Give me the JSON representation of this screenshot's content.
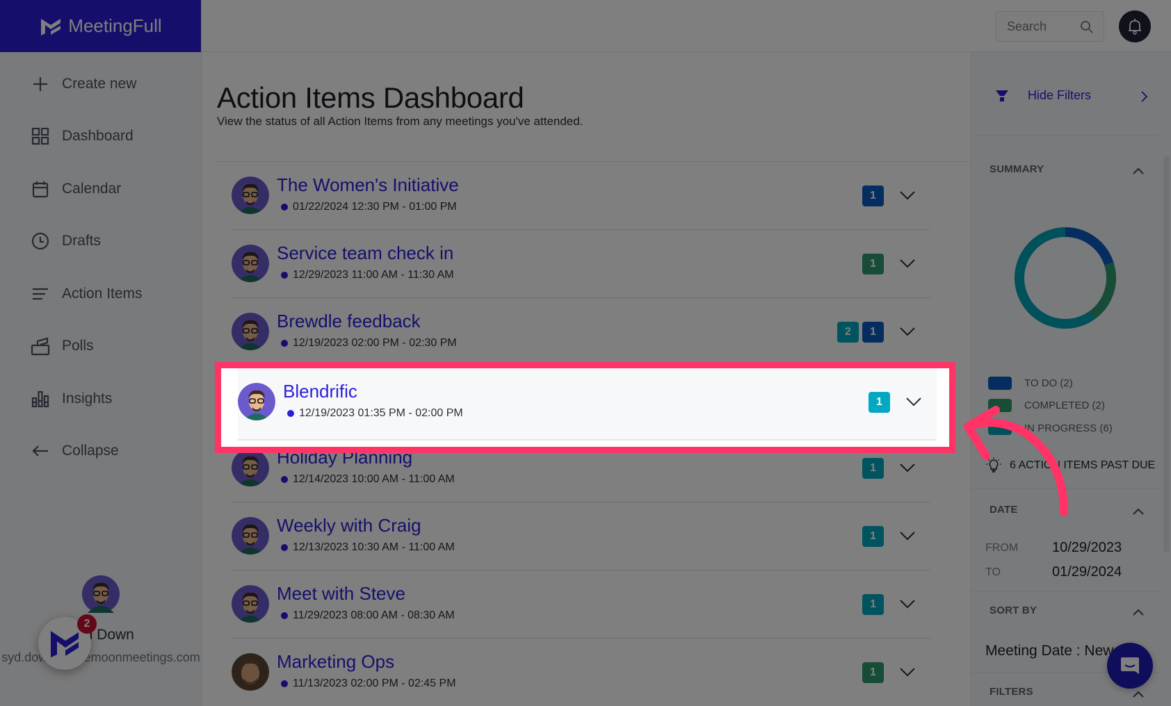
{
  "app": {
    "name": "MeetingFull"
  },
  "sidebar": {
    "items": [
      {
        "label": "Create new",
        "icon": "plus-icon"
      },
      {
        "label": "Dashboard",
        "icon": "grid-icon"
      },
      {
        "label": "Calendar",
        "icon": "calendar-icon"
      },
      {
        "label": "Drafts",
        "icon": "clock-icon"
      },
      {
        "label": "Action Items",
        "icon": "list-icon"
      },
      {
        "label": "Polls",
        "icon": "ballot-box-icon"
      },
      {
        "label": "Insights",
        "icon": "bar-chart-icon"
      },
      {
        "label": "Collapse",
        "icon": "arrow-left-icon"
      }
    ],
    "user": {
      "name": "Syd Down",
      "email": "syd.down@bluemoonmeetings.com"
    },
    "launcher_badge": "2"
  },
  "header": {
    "search_placeholder": "Search"
  },
  "main": {
    "title": "Action Items Dashboard",
    "subtitle": "View the status of all Action Items from any meetings you've attended.",
    "meetings": [
      {
        "title": "The Women's Initiative",
        "when": "01/22/2024 12:30 PM - 01:00 PM",
        "badges": [
          {
            "count": "1",
            "status": "todo"
          }
        ]
      },
      {
        "title": "Service team check in",
        "when": "12/29/2023 11:00 AM - 11:30 AM",
        "badges": [
          {
            "count": "1",
            "status": "completed"
          }
        ]
      },
      {
        "title": "Brewdle feedback",
        "when": "12/19/2023 02:00 PM - 02:30 PM",
        "badges": [
          {
            "count": "2",
            "status": "in_progress"
          },
          {
            "count": "1",
            "status": "todo"
          }
        ]
      },
      {
        "title": "Blendrific",
        "when": "12/19/2023 01:35 PM - 02:00 PM",
        "badges": [
          {
            "count": "1",
            "status": "in_progress"
          }
        ],
        "highlighted": true
      },
      {
        "title": "Holiday Planning",
        "when": "12/14/2023 10:00 AM - 11:00 AM",
        "badges": [
          {
            "count": "1",
            "status": "in_progress"
          }
        ]
      },
      {
        "title": "Weekly with Craig",
        "when": "12/13/2023 10:30 AM - 11:00 AM",
        "badges": [
          {
            "count": "1",
            "status": "in_progress"
          }
        ]
      },
      {
        "title": "Meet with Steve",
        "when": "11/29/2023 08:00 AM - 08:30 AM",
        "badges": [
          {
            "count": "1",
            "status": "in_progress"
          }
        ]
      },
      {
        "title": "Marketing Ops",
        "when": "11/13/2023 02:00 PM - 02:45 PM",
        "badges": [
          {
            "count": "1",
            "status": "completed"
          }
        ]
      }
    ]
  },
  "filters": {
    "hide_label": "Hide Filters",
    "summary": {
      "heading": "SUMMARY",
      "legend": [
        {
          "label": "TO DO (2)",
          "key": "todo"
        },
        {
          "label": "COMPLETED (2)",
          "key": "completed"
        },
        {
          "label": "IN PROGRESS (6)",
          "key": "in_progress"
        }
      ],
      "past_due": "6 ACTION ITEMS PAST DUE"
    },
    "date": {
      "heading": "DATE",
      "from_label": "FROM",
      "from": "10/29/2023",
      "to_label": "TO",
      "to": "01/29/2024"
    },
    "sort": {
      "heading": "SORT BY",
      "value": "Meeting Date : Newest"
    },
    "filters_heading": "FILTERS"
  },
  "colors": {
    "brand": "#2a1fd6",
    "todo": "#0a5bbf",
    "completed": "#2f9a6e",
    "in_progress": "#00a9c1",
    "in_progress_donut": "#00a3b5",
    "highlight": "#ff3366"
  },
  "chart_data": {
    "type": "pie",
    "title": "SUMMARY",
    "categories": [
      "TO DO",
      "COMPLETED",
      "IN PROGRESS"
    ],
    "values": [
      2,
      2,
      6
    ],
    "donut": true
  }
}
